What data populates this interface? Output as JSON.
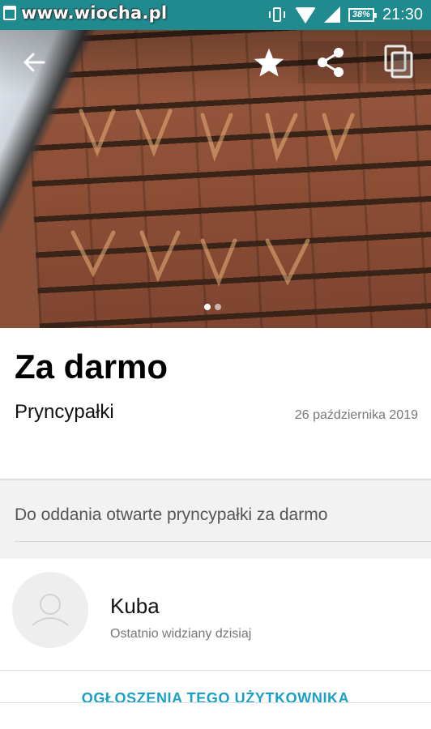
{
  "status_bar": {
    "watermark": "www.wiocha.pl",
    "battery": "38%",
    "time": "21:30"
  },
  "hero": {
    "icons": [
      "back-arrow-icon",
      "star-icon",
      "share-icon",
      "copy-icon"
    ],
    "page_count": 2,
    "active_page": 1
  },
  "listing": {
    "title": "Za darmo",
    "category": "Pryncypałki",
    "date": "26 października 2019",
    "description": "Do oddania otwarte pryncypałki za darmo"
  },
  "seller": {
    "name": "Kuba",
    "last_seen": "Ostatnio widziany dzisiaj",
    "more_ads_label": "OGŁOSZENIA TEGO UŻYTKOWNIKA"
  },
  "colors": {
    "status_bar": "#1f8b8f",
    "accent_link": "#1aa0c8"
  }
}
